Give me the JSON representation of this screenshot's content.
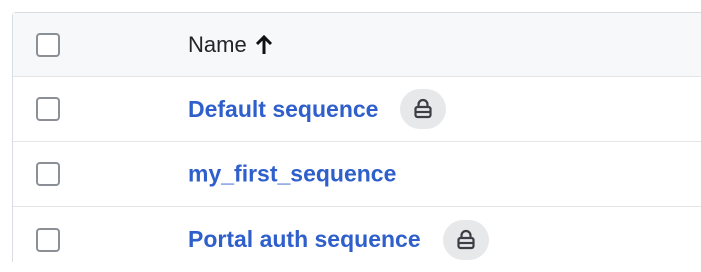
{
  "table": {
    "header": {
      "name_label": "Name",
      "sort_direction_icon": "arrow-up-icon"
    },
    "rows": [
      {
        "name": "Default sequence",
        "locked": true,
        "lock_icon": "lock-icon"
      },
      {
        "name": "my_first_sequence",
        "locked": false
      },
      {
        "name": "Portal auth sequence",
        "locked": true,
        "lock_icon": "lock-icon"
      }
    ]
  },
  "colors": {
    "link": "#2f5fcb",
    "header_background": "#f7f8fa",
    "border": "#d9dce1",
    "lock_badge": "#e7e8ea"
  }
}
